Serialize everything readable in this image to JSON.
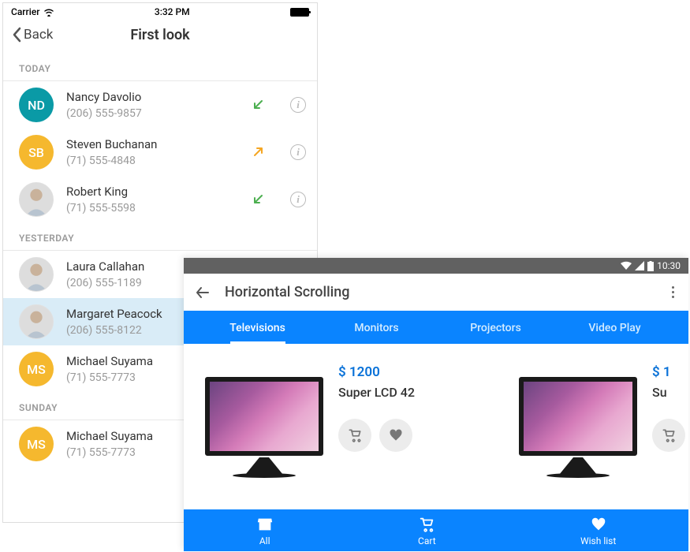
{
  "ios": {
    "status": {
      "carrier": "Carrier",
      "time": "3:32 PM"
    },
    "nav": {
      "back": "Back",
      "title": "First look"
    },
    "sections": [
      {
        "label": "TODAY",
        "contacts": [
          {
            "initials": "ND",
            "avatarColor": "#0a9aa6",
            "name": "Nancy Davolio",
            "phone": "(206) 555-9857",
            "direction": "in"
          },
          {
            "initials": "SB",
            "avatarColor": "#f5b82e",
            "name": "Steven Buchanan",
            "phone": "(71) 555-4848",
            "direction": "out"
          },
          {
            "initials": "",
            "avatarColor": "img",
            "name": "Robert King",
            "phone": "(71) 555-5598",
            "direction": "in"
          }
        ]
      },
      {
        "label": "YESTERDAY",
        "contacts": [
          {
            "initials": "",
            "avatarColor": "img",
            "name": "Laura Callahan",
            "phone": "(206) 555-1189",
            "direction": ""
          },
          {
            "initials": "",
            "avatarColor": "img",
            "name": "Margaret Peacock",
            "phone": "(206) 555-8122",
            "direction": "",
            "selected": true
          },
          {
            "initials": "MS",
            "avatarColor": "#f5b82e",
            "name": "Michael Suyama",
            "phone": "(71) 555-7773",
            "direction": ""
          }
        ]
      },
      {
        "label": "SUNDAY",
        "contacts": [
          {
            "initials": "MS",
            "avatarColor": "#f5b82e",
            "name": "Michael Suyama",
            "phone": "(71) 555-7773",
            "direction": ""
          }
        ]
      }
    ]
  },
  "android": {
    "status": {
      "time": "10:30"
    },
    "toolbar": {
      "title": "Horizontal Scrolling"
    },
    "tabs": [
      {
        "label": "Televisions",
        "active": true
      },
      {
        "label": "Monitors",
        "active": false
      },
      {
        "label": "Projectors",
        "active": false
      },
      {
        "label": "Video Play",
        "active": false
      }
    ],
    "products": [
      {
        "price": "$ 1200",
        "name": "Super LCD 42"
      },
      {
        "price": "$ 1",
        "name": "Su"
      }
    ],
    "bottomNav": [
      {
        "label": "All",
        "icon": "store"
      },
      {
        "label": "Cart",
        "icon": "cart"
      },
      {
        "label": "Wish list",
        "icon": "heart"
      }
    ]
  }
}
